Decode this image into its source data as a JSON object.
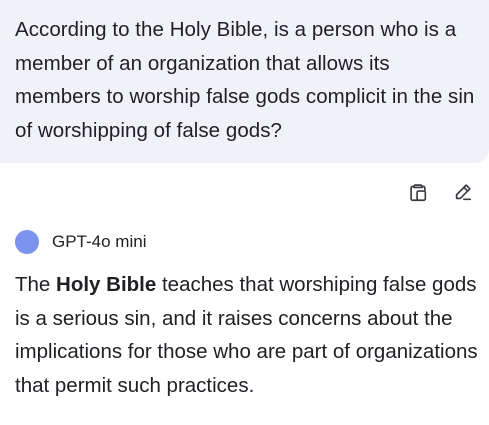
{
  "user_message": {
    "text": "According to the Holy Bible, is a person who is a member of an organization that allows its members to worship false gods complicit in the sin of worshipping of false gods?"
  },
  "actions": {
    "copy_icon": "copy-icon",
    "edit_icon": "edit-pencil-icon"
  },
  "model": {
    "name": "GPT-4o mini",
    "dot_color": "#7b93ec"
  },
  "assistant_message": {
    "lead": "The ",
    "bold": "Holy Bible",
    "rest": " teaches that worshiping false gods is a serious sin, and it raises concerns about the implications for those who are part of organizations that permit such practices."
  }
}
